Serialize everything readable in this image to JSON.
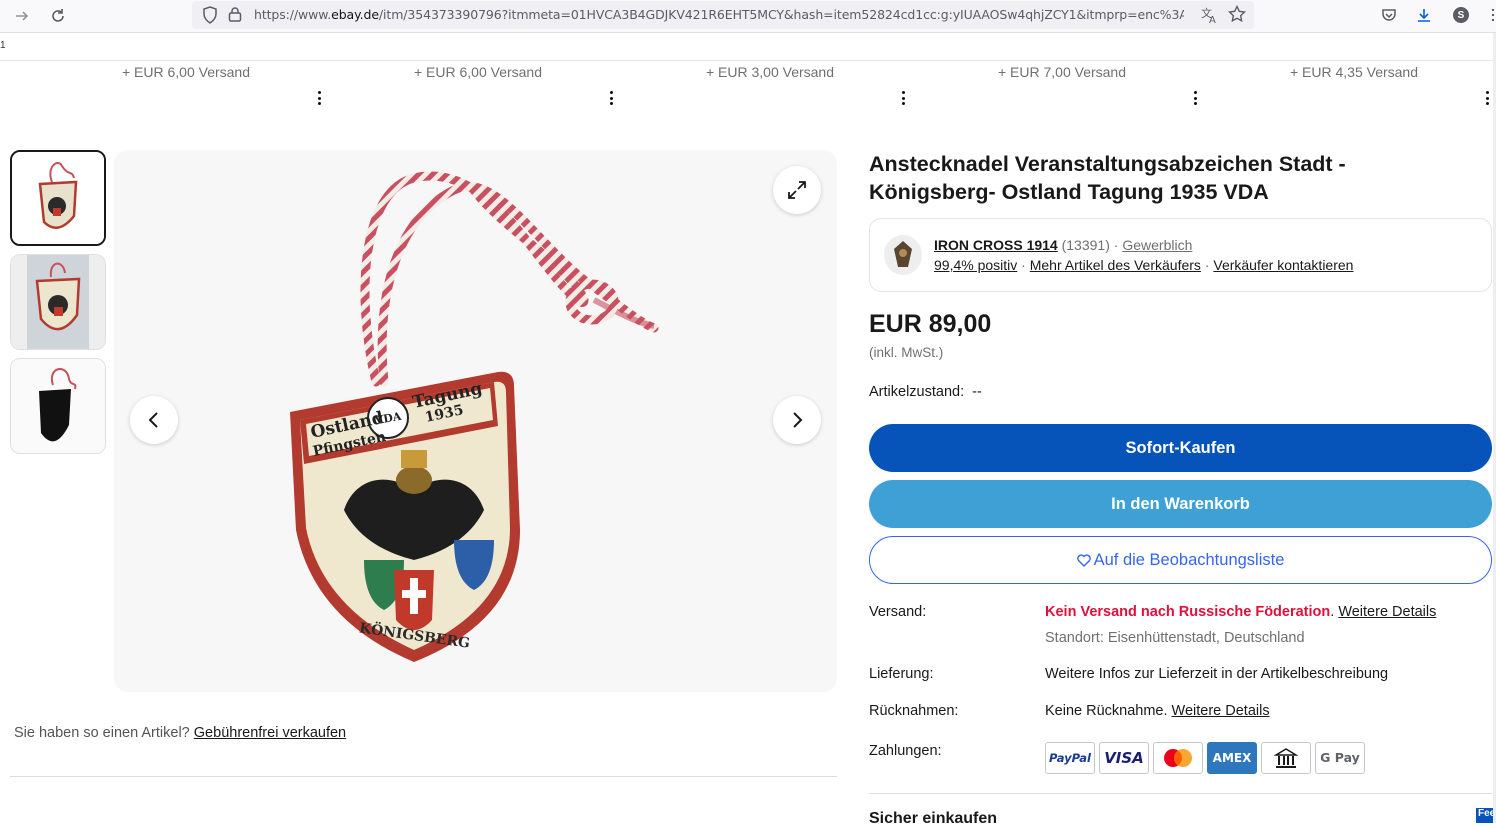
{
  "browser": {
    "url_prefix": "https://www.",
    "url_domain": "ebay.de",
    "url_rest": "/itm/354373390796?itmmeta=01HVCA3B4GDJKV421R6EHT5MCY&hash=item52824cd1cc:g:yIUAAOSw4qhjZCY1&itmprp=enc%3A",
    "profile_initial": "S"
  },
  "top_marker": "1",
  "shipping_row": [
    "+ EUR 6,00 Versand",
    "+ EUR 6,00 Versand",
    "+ EUR 3,00 Versand",
    "+ EUR 7,00 Versand",
    "+ EUR 4,35 Versand"
  ],
  "listing": {
    "title": "Anstecknadel Veranstaltungsabzeichen Stadt - Königsberg- Ostland Tagung 1935 VDA",
    "badge_text": {
      "top_left": "Ostland",
      "top_left2": "Pfingsten",
      "top_right": "Tagung",
      "year": "1935",
      "bottom": "KÖNIGSBERG",
      "emblem": "VDA"
    },
    "price": "EUR 89,00",
    "tax_note": "(inkl. MwSt.)",
    "condition_label": "Artikelzustand:",
    "condition_value": "--"
  },
  "seller": {
    "name": "IRON CROSS 1914",
    "count": "(13391)",
    "separator": "·",
    "type": "Gewerblich",
    "feedback": "99,4% positiv",
    "more_items": "Mehr Artikel des Verkäufers",
    "contact": "Verkäufer kontaktieren"
  },
  "buttons": {
    "buy_now": "Sofort-Kaufen",
    "add_cart": "In den Warenkorb",
    "watchlist": "Auf die Beobachtungsliste"
  },
  "details": {
    "shipping_label": "Versand:",
    "shipping_warning": "Kein Versand nach Russische Föderation",
    "shipping_period": ".",
    "shipping_link": "Weitere Details",
    "location": "Standort: Eisenhüttenstadt, Deutschland",
    "delivery_label": "Lieferung:",
    "delivery_value": "Weitere Infos zur Lieferzeit in der Artikelbeschreibung",
    "returns_label": "Rücknahmen:",
    "returns_value": "Keine Rücknahme.",
    "returns_link": "Weitere Details",
    "payments_label": "Zahlungen:",
    "payment_methods": [
      "PayPal",
      "VISA",
      "Mastercard",
      "AMEX",
      "Bank",
      "G Pay"
    ]
  },
  "sell_prompt": {
    "text": "Sie haben so einen Artikel?",
    "link": "Gebührenfrei verkaufen"
  },
  "safe_shopping": "Sicher einkaufen",
  "feedback_tab": "Fee",
  "colors": {
    "buy": "#0654ba",
    "cart": "#3fa0d6",
    "watch": "#3665f3",
    "warning": "#e0103a"
  }
}
